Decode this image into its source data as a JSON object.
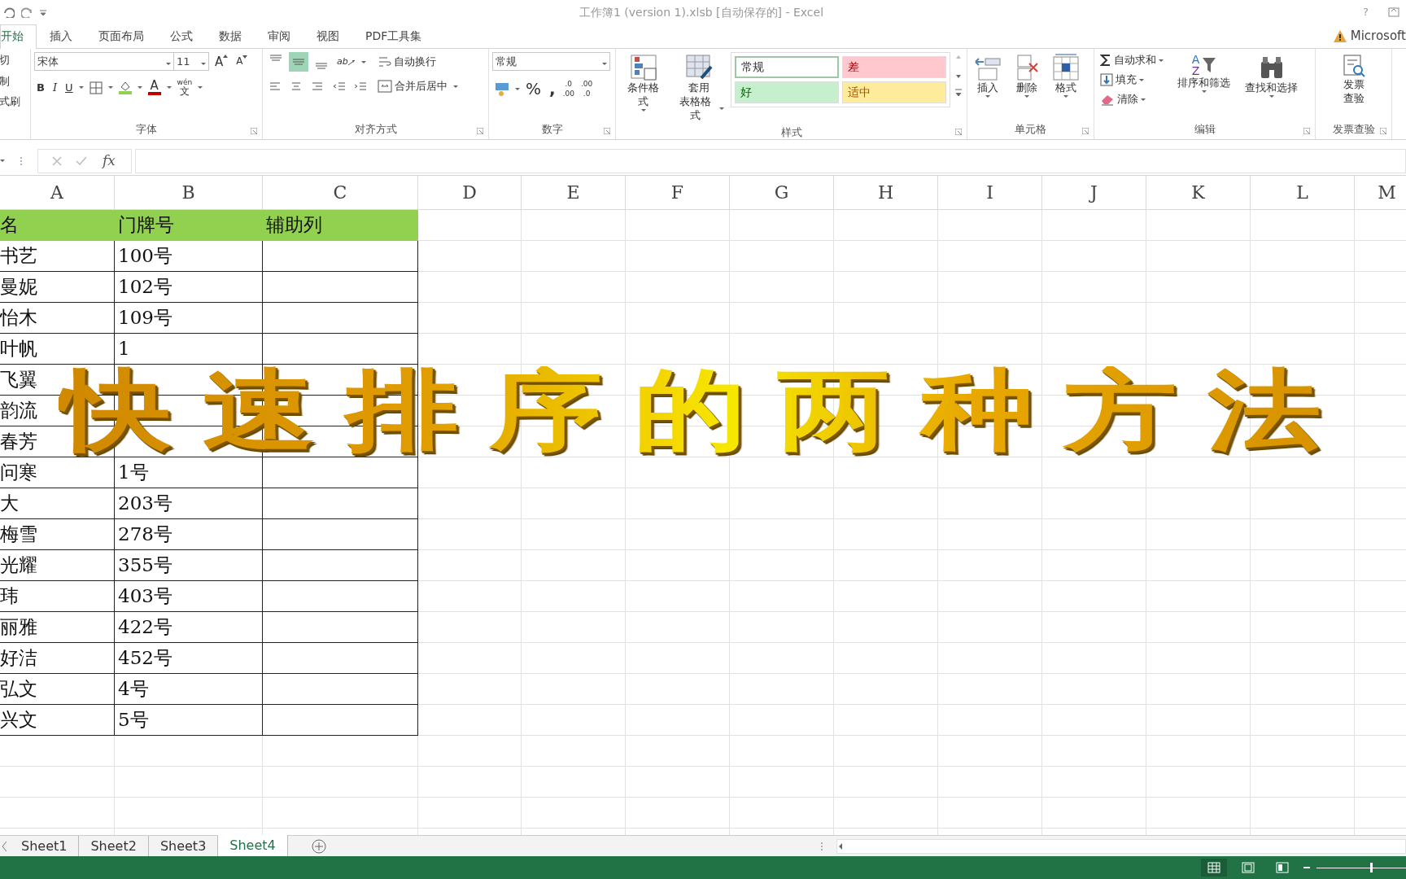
{
  "window": {
    "title": "工作簿1 (version 1).xlsb [自动保存的] - Excel",
    "help": "?"
  },
  "tabs": [
    {
      "label": "开始",
      "selected": true
    },
    {
      "label": "插入",
      "selected": false
    },
    {
      "label": "页面布局",
      "selected": false
    },
    {
      "label": "公式",
      "selected": false
    },
    {
      "label": "数据",
      "selected": false
    },
    {
      "label": "审阅",
      "selected": false
    },
    {
      "label": "视图",
      "selected": false
    },
    {
      "label": "PDF工具集",
      "selected": false
    }
  ],
  "account": {
    "label": "Microsoft"
  },
  "ribbon": {
    "clipboard": {
      "items": [
        "切",
        "制",
        "式刷"
      ]
    },
    "font": {
      "name": "宋体",
      "size": "11",
      "grow": "A",
      "shrink": "A",
      "color_letter": "A",
      "bold": "B",
      "italic": "I",
      "underline": "U",
      "phonetic_top": "wén",
      "phonetic_bottom": "文",
      "label": "字体"
    },
    "alignment": {
      "vertical": [
        {
          "selected": false
        },
        {
          "selected": true
        },
        {
          "selected": false
        }
      ],
      "orientation": "ab",
      "wrap": "自动换行",
      "merge": "合并后居中",
      "label": "对齐方式"
    },
    "number": {
      "format": "常规",
      "percent": "%",
      "comma": ",",
      "add_decimal": [
        ".0",
        ".00"
      ],
      "remove_decimal": [
        ".00",
        ".0"
      ],
      "label": "数字"
    },
    "styles": {
      "conditional": "条件格式",
      "table_format_top": "套用",
      "table_format_bottom": "表格格式",
      "cells": [
        {
          "label": "常规",
          "color": "#ffffff",
          "selected": true
        },
        {
          "label": "差",
          "color": "#ffc7ce",
          "selected": false
        },
        {
          "label": "好",
          "color": "#c6efce",
          "selected": false
        },
        {
          "label": "适中",
          "color": "#ffeb9c",
          "selected": false
        }
      ],
      "label": "样式"
    },
    "cells": {
      "buttons": [
        "插入",
        "删除",
        "格式"
      ],
      "label": "单元格"
    },
    "editing": {
      "autosum": "自动求和",
      "fill": "填充",
      "clear": "清除",
      "sort_letters": [
        "A",
        "Z"
      ],
      "sort": "排序和筛选",
      "find": "查找和选择",
      "label": "编辑"
    },
    "invoice": {
      "button_top": "发票",
      "button_bottom": "查验",
      "label": "发票查验"
    }
  },
  "formula_bar": {
    "fx": "fx"
  },
  "sheet": {
    "columns": [
      "A",
      "B",
      "C",
      "D",
      "E",
      "F",
      "G",
      "H",
      "I",
      "J",
      "K",
      "L",
      "M"
    ],
    "header": [
      "名",
      "门牌号",
      "辅助列"
    ],
    "rows": [
      {
        "a": "书艺",
        "b": "100号"
      },
      {
        "a": "曼妮",
        "b": "102号"
      },
      {
        "a": "怡木",
        "b": "109号"
      },
      {
        "a": "叶帆",
        "b": "1"
      },
      {
        "a": "飞翼"
      },
      {
        "a": "韵流"
      },
      {
        "a": "春芳"
      },
      {
        "a": "问寒",
        "b": "1号"
      },
      {
        "a": "大",
        "b": "203号"
      },
      {
        "a": "梅雪",
        "b": "278号"
      },
      {
        "a": "光耀",
        "b": "355号"
      },
      {
        "a": "玮",
        "b": "403号"
      },
      {
        "a": "丽雅",
        "b": "422号"
      },
      {
        "a": "好洁",
        "b": "452号"
      },
      {
        "a": "弘文",
        "b": "4号"
      },
      {
        "a": "兴文",
        "b": "5号"
      }
    ]
  },
  "overlay_title": "快速排序的两种方法",
  "sheet_tabs": [
    {
      "label": "Sheet1",
      "selected": false
    },
    {
      "label": "Sheet2",
      "selected": false
    },
    {
      "label": "Sheet3",
      "selected": false
    },
    {
      "label": "Sheet4",
      "selected": true
    }
  ],
  "status_bar": {
    "views": [
      {
        "selected": true
      },
      {
        "selected": false
      },
      {
        "selected": false
      }
    ],
    "zoom": {
      "level": 0.6
    }
  }
}
